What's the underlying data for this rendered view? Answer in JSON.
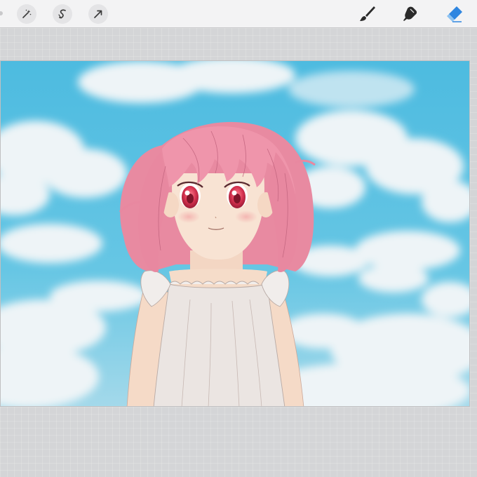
{
  "app": {
    "name": "drawing-app"
  },
  "toolbar": {
    "left_tools": [
      {
        "name": "adjustments-tool",
        "icon": "magic-wand-icon"
      },
      {
        "name": "selection-tool",
        "icon": "s-curve-icon"
      },
      {
        "name": "transform-tool",
        "icon": "arrow-cursor-icon"
      }
    ],
    "right_tools": [
      {
        "name": "brush-tool",
        "icon": "brush-icon",
        "active": false
      },
      {
        "name": "smudge-tool",
        "icon": "smudge-finger-icon",
        "active": false
      },
      {
        "name": "eraser-tool",
        "icon": "eraser-icon",
        "active": true
      }
    ],
    "colors": {
      "active_tool": "#2f86e0",
      "inactive_tool": "#2a2a2a",
      "toolbar_bg": "#f3f3f4"
    }
  },
  "canvas": {
    "artwork": "girl-with-pink-hair-under-clouds",
    "colors": {
      "sky": "#4fbfe0",
      "hair": "#ec8fa6",
      "eyes": "#d23a55",
      "dress": "#ece6e3",
      "skin": "#f6dcc9"
    }
  }
}
